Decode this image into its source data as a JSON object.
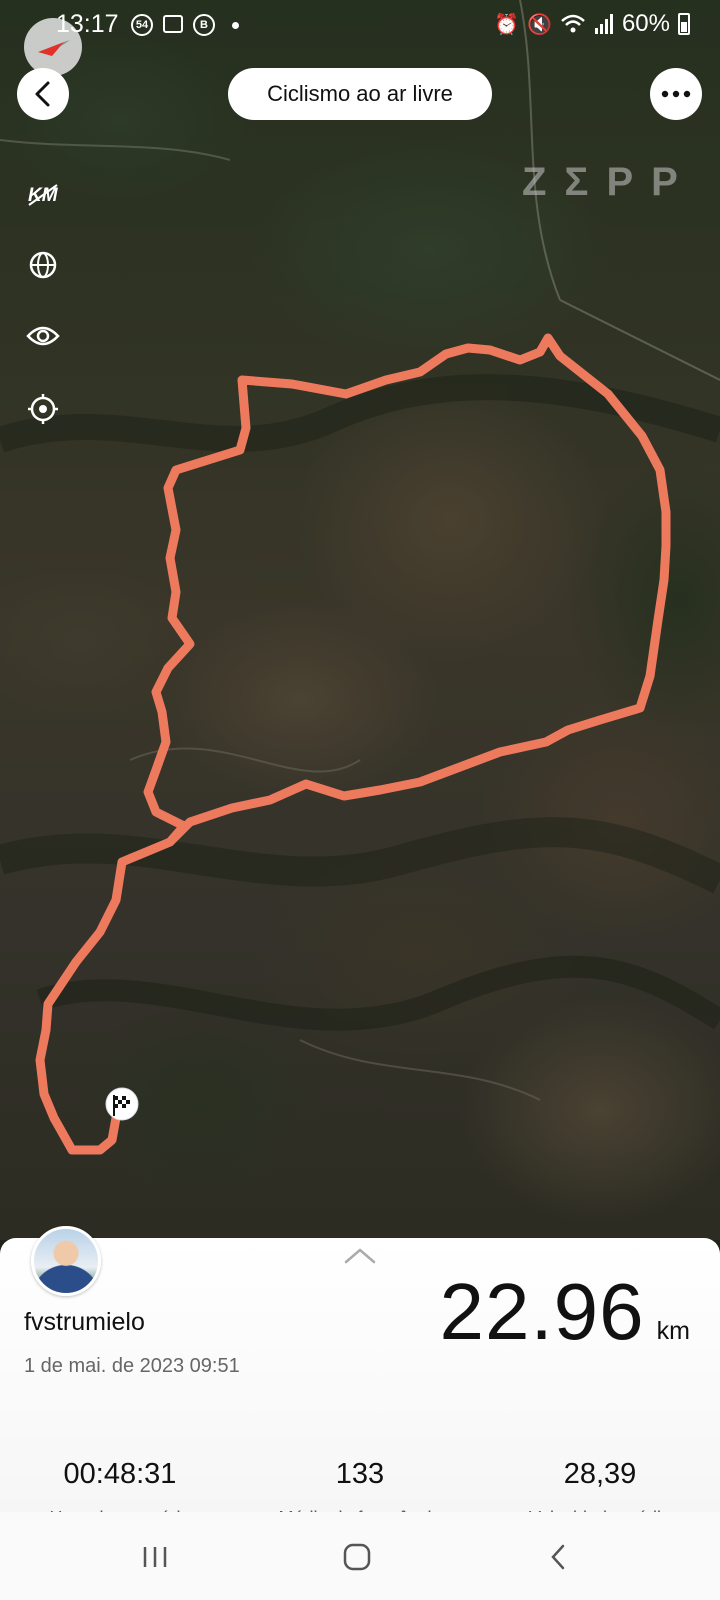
{
  "status_bar": {
    "time": "13:17",
    "notification_badge": "54",
    "b_badge": "B",
    "battery": "60%"
  },
  "header": {
    "title": "Ciclismo ao ar livre",
    "brand": "ZΣPP"
  },
  "map_tools": {
    "km_toggle": "KM"
  },
  "map": {
    "route_color": "#ee7a5e",
    "icons": [
      "compass-icon",
      "back-icon",
      "more-icon",
      "km-icon",
      "globe-icon",
      "eye-icon",
      "locate-icon",
      "finish-flag-icon"
    ]
  },
  "workout": {
    "username": "fvstrumielo",
    "datetime": "1 de mai. de 2023 09:51",
    "distance_value": "22.96",
    "distance_unit": "km",
    "stats": [
      {
        "value": "00:48:31",
        "label": "Hora do exercício"
      },
      {
        "value": "133",
        "label": "Média de frequência"
      },
      {
        "value": "28,39",
        "label": "Velocidade média"
      }
    ]
  }
}
